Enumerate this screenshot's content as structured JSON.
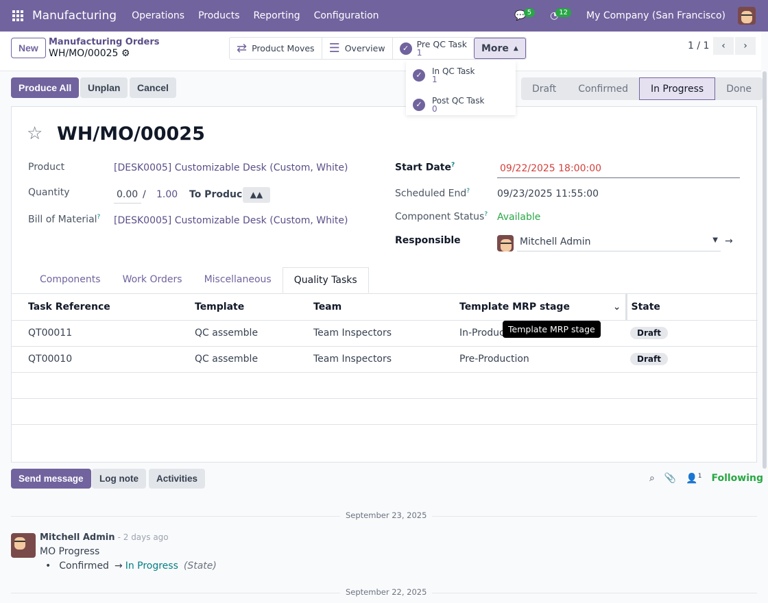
{
  "navbar": {
    "app": "Manufacturing",
    "menus": [
      "Operations",
      "Products",
      "Reporting",
      "Configuration"
    ],
    "messages_count": "5",
    "activities_count": "12",
    "company": "My Company (San Francisco)"
  },
  "control": {
    "new": "New",
    "breadcrumb_parent": "Manufacturing Orders",
    "breadcrumb_current": "WH/MO/00025",
    "pager": "1 / 1",
    "smart_buttons": {
      "moves": "Product Moves",
      "overview": "Overview",
      "pre_qc": "Pre QC Task",
      "pre_qc_count": "1",
      "more": "More"
    },
    "dropdown": [
      {
        "label": "In QC Task",
        "count": "1"
      },
      {
        "label": "Post QC Task",
        "count": "0"
      }
    ]
  },
  "actions": {
    "produce_all": "Produce All",
    "unplan": "Unplan",
    "cancel": "Cancel"
  },
  "statusbar": {
    "stages": [
      "Draft",
      "Confirmed",
      "In Progress",
      "Done"
    ],
    "active": "In Progress"
  },
  "form": {
    "title": "WH/MO/00025",
    "product_label": "Product",
    "product": "[DESK0005] Customizable Desk (Custom, White)",
    "quantity_label": "Quantity",
    "qty_produced": "0.00",
    "qty_sep": "/",
    "qty_total": "1.00",
    "to_produce": "To Produce",
    "bom_label": "Bill of Material",
    "bom": "[DESK0005] Customizable Desk (Custom, White)",
    "start_label": "Start Date",
    "start": "09/22/2025 18:00:00",
    "end_label": "Scheduled End",
    "end": "09/23/2025 11:55:00",
    "component_label": "Component Status",
    "component": "Available",
    "responsible_label": "Responsible",
    "responsible": "Mitchell Admin",
    "help": "?"
  },
  "tabs": [
    "Components",
    "Work Orders",
    "Miscellaneous",
    "Quality Tasks"
  ],
  "table": {
    "headers": [
      "Task Reference",
      "Template",
      "Team",
      "Template MRP stage",
      "State"
    ],
    "rows": [
      [
        "QT00011",
        "QC assemble",
        "Team Inspectors",
        "In-Produc",
        "Draft"
      ],
      [
        "QT00010",
        "QC assemble",
        "Team Inspectors",
        "Pre-Production",
        "Draft"
      ]
    ],
    "tooltip": "Template MRP stage"
  },
  "chatter": {
    "send": "Send message",
    "log": "Log note",
    "activities": "Activities",
    "followers": "1",
    "following": "Following",
    "date1": "September 23, 2025",
    "author": "Mitchell Admin",
    "time": "- 2 days ago",
    "body": "MO Progress",
    "old": "Confirmed",
    "arrow": "→",
    "new": "In Progress",
    "field": "(State)",
    "date2": "September 22, 2025"
  },
  "colors": {
    "brand": "#71639e",
    "danger": "#d23f3a",
    "success": "#28a745",
    "info": "#017e84"
  }
}
